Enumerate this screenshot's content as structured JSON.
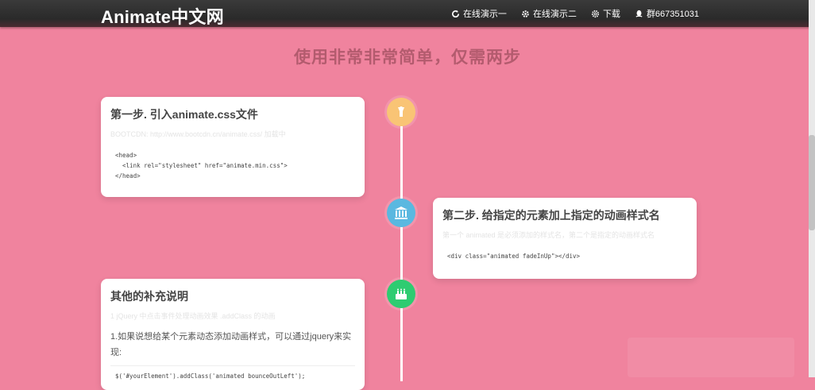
{
  "nav": {
    "brand": "Animate中文网",
    "links": [
      {
        "label": "在线演示一",
        "icon": "refresh-icon"
      },
      {
        "label": "在线演示二",
        "icon": "gear-icon"
      },
      {
        "label": "下载",
        "icon": "cog-icon"
      },
      {
        "label": "群667351031",
        "icon": "qq-icon"
      }
    ]
  },
  "section_title": "使用非常非常简单，仅需两步",
  "colors": {
    "background": "#f0839e",
    "step1_icon": "#f9c475",
    "step2_icon": "#5ab8e0",
    "step3_icon": "#2ecc71"
  },
  "cards": {
    "step1": {
      "title": "第一步. 引入animate.css文件",
      "faint": "BOOTCDN: http://www.bootcdn.cn/animate.css/ 加载中",
      "code": "<head>\n  <link rel=\"stylesheet\" href=\"animate.min.css\">\n</head>"
    },
    "step2": {
      "title": "第二步. 给指定的元素加上指定的动画样式名",
      "faint": "第一个 animated 是必须添加的样式名，第二个是指定的动画样式名",
      "code": "<div class=\"animated fadeInUp\"></div>"
    },
    "step3": {
      "title": "其他的补充说明",
      "faint": "1 jQuery 中点击事件处理动画效果 .addClass 的动画",
      "desc": "1.如果说想给某个元素动态添加动画样式，可以通过jquery来实现:",
      "code": "$('#yourElement').addClass('animated bounceOutLeft');"
    }
  }
}
